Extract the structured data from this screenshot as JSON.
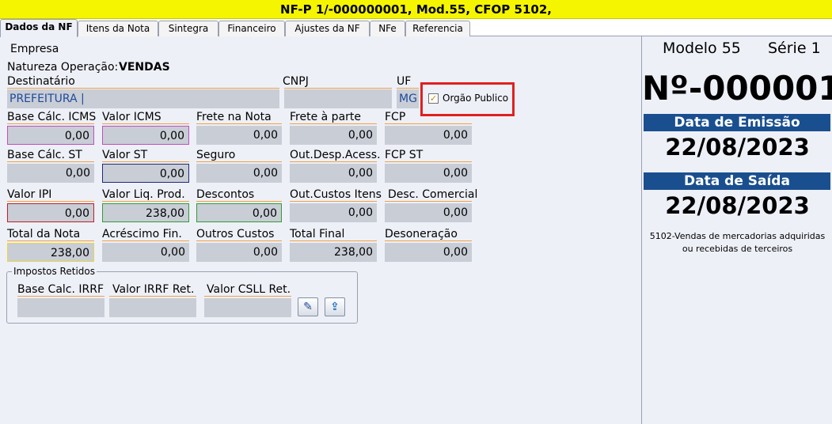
{
  "title": "NF-P 1/-000000001, Mod.55, CFOP 5102,",
  "tabs": [
    "Dados da NF",
    "Itens da Nota",
    "Sintegra",
    "Financeiro",
    "Ajustes da NF",
    "NFe",
    "Referencia"
  ],
  "empresa_label": "Empresa",
  "natureza": {
    "label": "Natureza Operação:",
    "value": "VENDAS"
  },
  "destinatario": {
    "label": "Destinatário",
    "value": "PREFEITURA |"
  },
  "cnpj": {
    "label": "CNPJ",
    "value": ""
  },
  "uf": {
    "label": "UF",
    "value": "MG"
  },
  "orgao_publico": {
    "label": "Orgão Publico",
    "checked": true,
    "mark": "✓"
  },
  "fields": {
    "base_icms": {
      "label": "Base Cálc. ICMS",
      "value": "0,00"
    },
    "valor_icms": {
      "label": "Valor ICMS",
      "value": "0,00"
    },
    "frete_nota": {
      "label": "Frete na Nota",
      "value": "0,00"
    },
    "frete_parte": {
      "label": "Frete à parte",
      "value": "0,00"
    },
    "fcp": {
      "label": "FCP",
      "value": "0,00"
    },
    "base_st": {
      "label": "Base Cálc. ST",
      "value": "0,00"
    },
    "valor_st": {
      "label": "Valor ST",
      "value": "0,00"
    },
    "seguro": {
      "label": "Seguro",
      "value": "0,00"
    },
    "out_desp": {
      "label": "Out.Desp.Acess.",
      "value": "0,00"
    },
    "fcp_st": {
      "label": "FCP ST",
      "value": "0,00"
    },
    "valor_ipi": {
      "label": "Valor IPI",
      "value": "0,00"
    },
    "valor_liq": {
      "label": "Valor Liq. Prod.",
      "value": "238,00"
    },
    "descontos": {
      "label": "Descontos",
      "value": "0,00"
    },
    "out_custos": {
      "label": "Out.Custos Itens",
      "value": "0,00"
    },
    "desc_comercial": {
      "label": "Desc. Comercial",
      "value": "0,00"
    },
    "total_nota": {
      "label": "Total da Nota",
      "value": "238,00"
    },
    "acrescimo": {
      "label": "Acréscimo Fin.",
      "value": "0,00"
    },
    "outros_custos": {
      "label": "Outros Custos",
      "value": "0,00"
    },
    "total_final": {
      "label": "Total Final",
      "value": "238,00"
    },
    "desoneracao": {
      "label": "Desoneração",
      "value": "0,00"
    }
  },
  "impostos": {
    "title": "Impostos Retidos",
    "base_irrf": "Base Calc. IRRF",
    "valor_irrf": "Valor IRRF Ret.",
    "valor_csll": "Valor CSLL Ret.",
    "edit_icon": "✎",
    "upload_icon": "⇪"
  },
  "side": {
    "modelo": "Modelo 55",
    "serie": "Série 1",
    "numero": "Nº-000001",
    "data_emissao_label": "Data de Emissão",
    "data_emissao": "22/08/2023",
    "data_saida_label": "Data de Saída",
    "data_saida": "22/08/2023",
    "cfop_desc_1": "5102-Vendas de mercadorias adquiridas",
    "cfop_desc_2": "ou recebidas de terceiros"
  }
}
